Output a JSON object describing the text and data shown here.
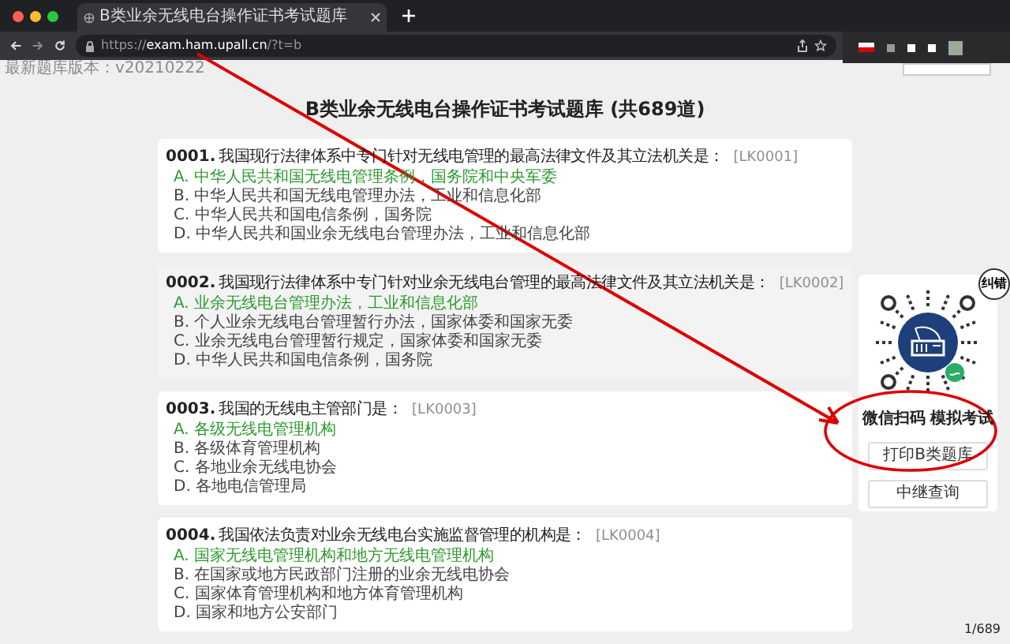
{
  "browser": {
    "tab_title": "B类业余无线电台操作证书考试题库",
    "url_scheme": "https://",
    "url_host": "exam.ham.upall.cn",
    "url_path": "/?t=b"
  },
  "version": "最新题库版本：v20210222",
  "title": {
    "prefix": "B类业余无线电台操作证书考试题库 (共",
    "count": "689",
    "suffix": "道)"
  },
  "questions": [
    {
      "number": "0001.",
      "text": "我国现行法律体系中专门针对无线电管理的最高法律文件及其立法机关是：",
      "code": "[LK0001]",
      "highlighted": false,
      "options": [
        {
          "letter": "A.",
          "text": "中华人民共和国无线电管理条例，国务院和中央军委",
          "correct": true
        },
        {
          "letter": "B.",
          "text": "中华人民共和国无线电管理办法，工业和信息化部",
          "correct": false
        },
        {
          "letter": "C.",
          "text": "中华人民共和国电信条例，国务院",
          "correct": false
        },
        {
          "letter": "D.",
          "text": "中华人民共和国业余无线电台管理办法，工业和信息化部",
          "correct": false
        }
      ]
    },
    {
      "number": "0002.",
      "text": "我国现行法律体系中专门针对业余无线电台管理的最高法律文件及其立法机关是：",
      "code": "[LK0002]",
      "highlighted": true,
      "options": [
        {
          "letter": "A.",
          "text": "业余无线电台管理办法，工业和信息化部",
          "correct": true
        },
        {
          "letter": "B.",
          "text": "个人业余无线电台管理暂行办法，国家体委和国家无委",
          "correct": false
        },
        {
          "letter": "C.",
          "text": "业余无线电台管理暂行规定，国家体委和国家无委",
          "correct": false
        },
        {
          "letter": "D.",
          "text": "中华人民共和国电信条例，国务院",
          "correct": false
        }
      ]
    },
    {
      "number": "0003.",
      "text": "我国的无线电主管部门是：",
      "code": "[LK0003]",
      "highlighted": false,
      "options": [
        {
          "letter": "A.",
          "text": "各级无线电管理机构",
          "correct": true
        },
        {
          "letter": "B.",
          "text": "各级体育管理机构",
          "correct": false
        },
        {
          "letter": "C.",
          "text": "各地业余无线电协会",
          "correct": false
        },
        {
          "letter": "D.",
          "text": "各地电信管理局",
          "correct": false
        }
      ]
    },
    {
      "number": "0004.",
      "text": "我国依法负责对业余无线电台实施监督管理的机构是：",
      "code": "[LK0004]",
      "highlighted": false,
      "options": [
        {
          "letter": "A.",
          "text": "国家无线电管理机构和地方无线电管理机构",
          "correct": true
        },
        {
          "letter": "B.",
          "text": "在国家或地方民政部门注册的业余无线电协会",
          "correct": false
        },
        {
          "letter": "C.",
          "text": "国家体育管理机构和地方体育管理机构",
          "correct": false
        },
        {
          "letter": "D.",
          "text": "国家和地方公安部门",
          "correct": false
        }
      ]
    }
  ],
  "sidebar": {
    "badge": "纠错",
    "caption": "微信扫码 模拟考试",
    "buttons": [
      "打印B类题库",
      "中继查询"
    ]
  },
  "page_counter": "1/689"
}
